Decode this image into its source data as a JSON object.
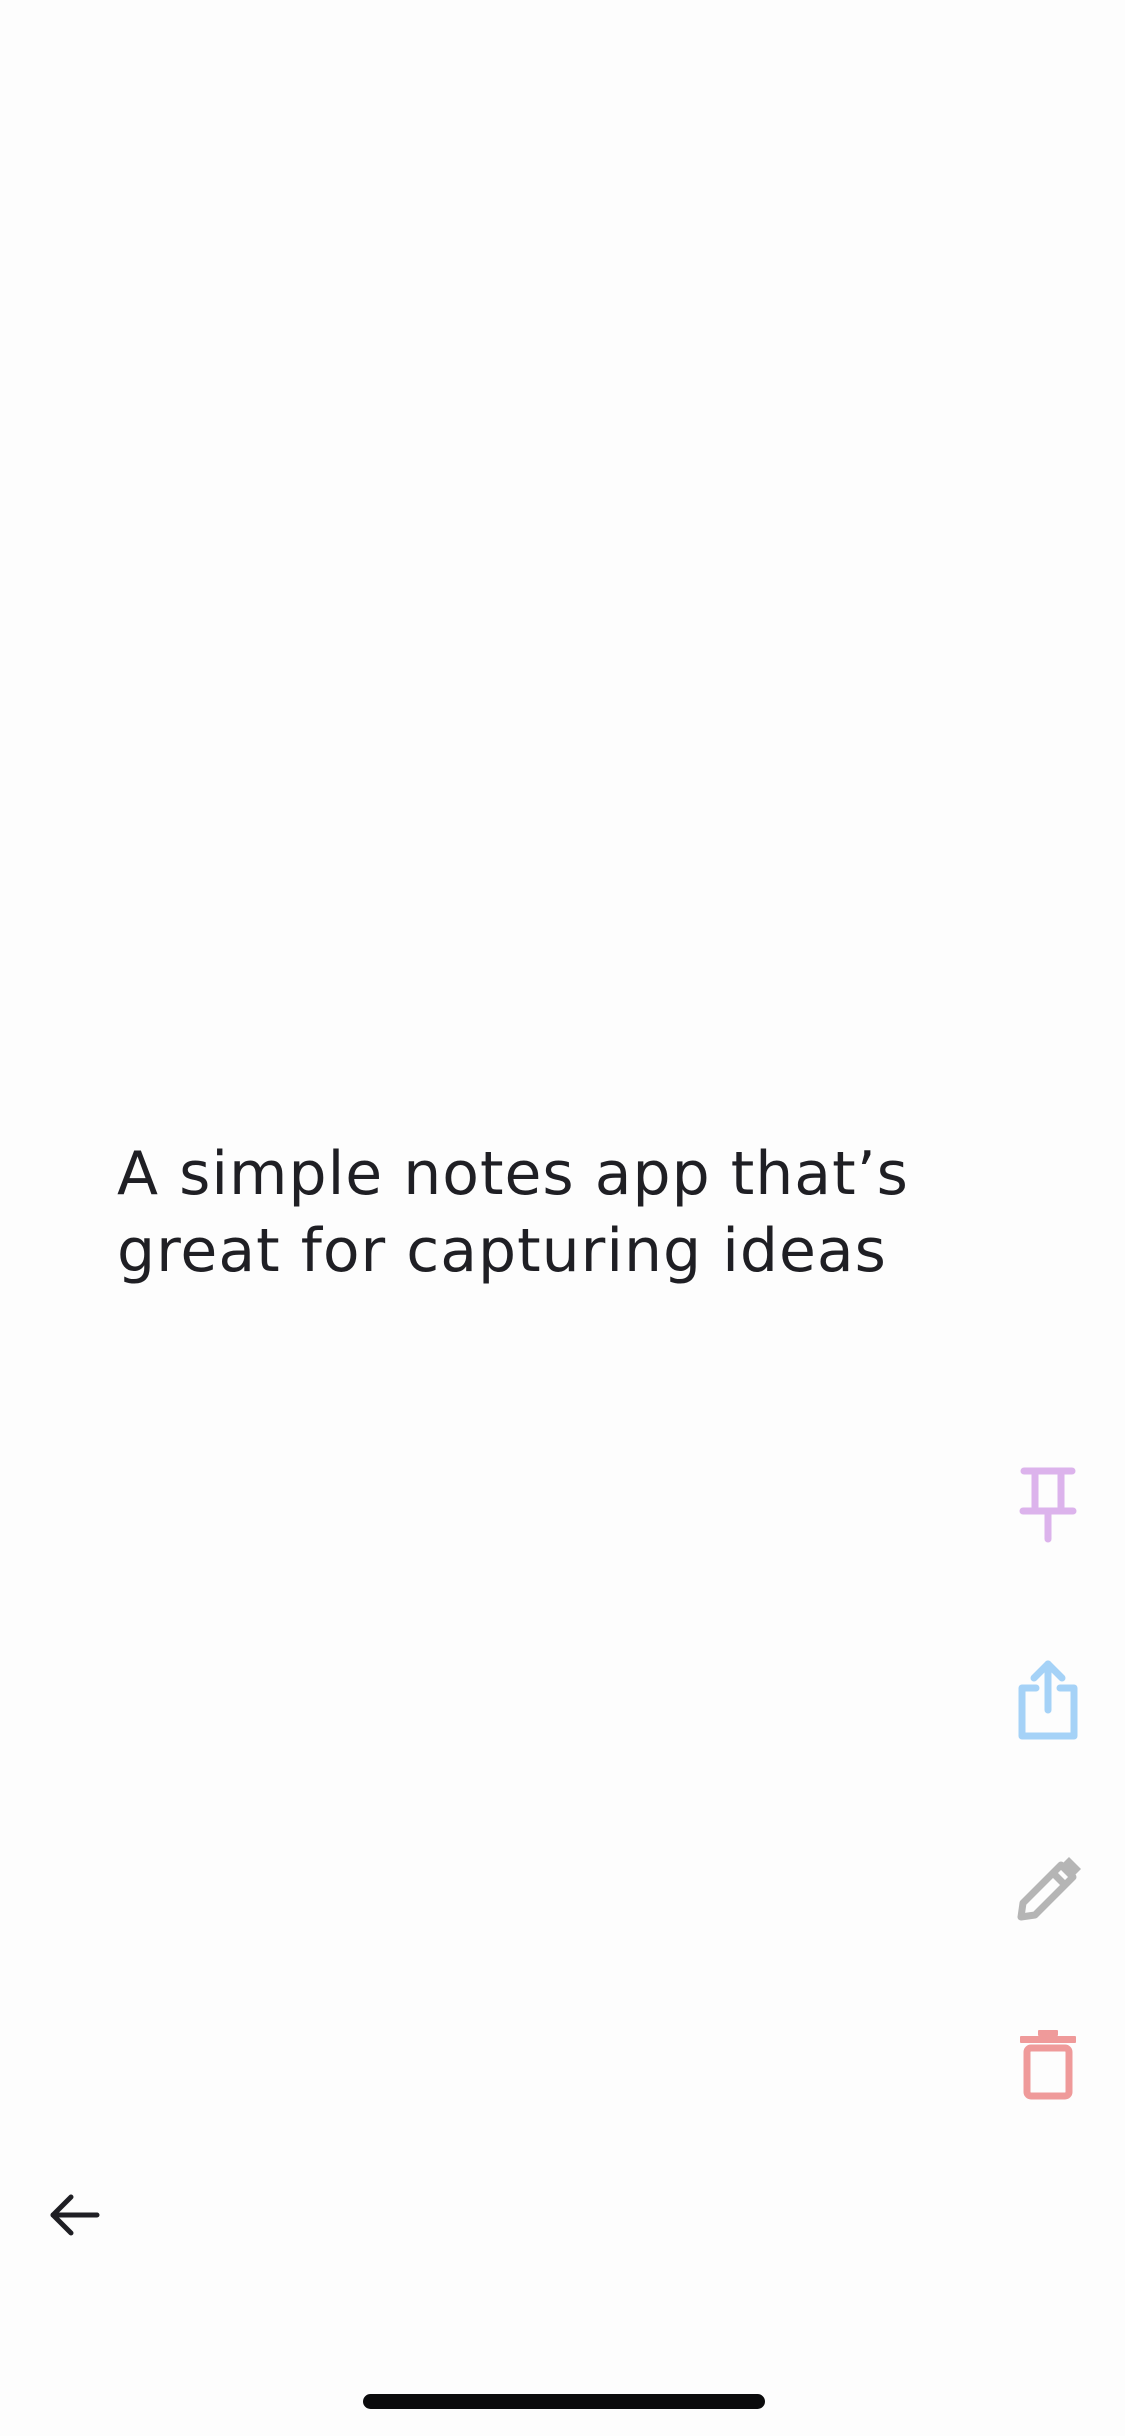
{
  "note": {
    "lines": [
      "A simple notes app that’s",
      "great for capturing ideas"
    ]
  },
  "actions": {
    "pin": {
      "icon": "pin-icon",
      "color": "#dcb3ec"
    },
    "share": {
      "icon": "share-icon",
      "color": "#a5d2f7"
    },
    "edit": {
      "icon": "pencil-icon",
      "color": "#b5b5b5"
    },
    "delete": {
      "icon": "trash-icon",
      "color": "#ef9a9a"
    }
  },
  "navigation": {
    "back_icon": "arrow-left-icon",
    "back_color": "#1f1f24"
  }
}
